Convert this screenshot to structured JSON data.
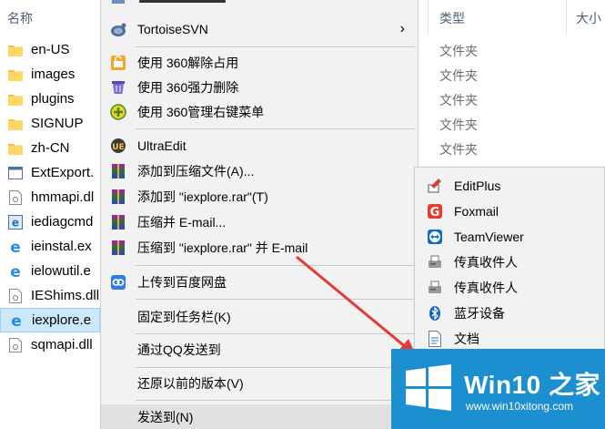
{
  "explorer": {
    "name_header": "名称",
    "type_header": "类型",
    "size_header": "大小",
    "files": [
      {
        "name": "en-US",
        "icon": "folder-icon"
      },
      {
        "name": "images",
        "icon": "folder-icon"
      },
      {
        "name": "plugins",
        "icon": "folder-icon"
      },
      {
        "name": "SIGNUP",
        "icon": "folder-icon"
      },
      {
        "name": "zh-CN",
        "icon": "folder-icon"
      },
      {
        "name": "ExtExport.",
        "icon": "app-icon"
      },
      {
        "name": "hmmapi.dl",
        "icon": "dll-icon"
      },
      {
        "name": "iediagcmd",
        "icon": "ie-diag-icon"
      },
      {
        "name": "ieinstal.ex",
        "icon": "ie-icon"
      },
      {
        "name": "ielowutil.e",
        "icon": "ie-icon"
      },
      {
        "name": "IEShims.dll",
        "icon": "dll-icon"
      },
      {
        "name": "iexplore.e",
        "icon": "ie-icon",
        "selected": true
      },
      {
        "name": "sqmapi.dll",
        "icon": "dll-icon"
      }
    ],
    "types": [
      "文件夹",
      "文件夹",
      "文件夹",
      "文件夹",
      "文件夹"
    ]
  },
  "context_menu": {
    "items": [
      {
        "label": "TortoiseSVN",
        "icon": "tortoisesvn-icon",
        "submenu": true
      },
      {
        "label": "使用 360解除占用",
        "icon": "360-unlock-icon"
      },
      {
        "label": "使用 360强力删除",
        "icon": "360-shred-icon"
      },
      {
        "label": "使用 360管理右键菜单",
        "icon": "360-manage-icon"
      },
      {
        "label": "UltraEdit",
        "icon": "ultraedit-icon"
      },
      {
        "label": "添加到压缩文件(A)...",
        "icon": "winrar-icon"
      },
      {
        "label": "添加到 \"iexplore.rar\"(T)",
        "icon": "winrar-icon"
      },
      {
        "label": "压缩并 E-mail...",
        "icon": "winrar-icon"
      },
      {
        "label": "压缩到 \"iexplore.rar\" 并 E-mail",
        "icon": "winrar-icon"
      },
      {
        "label": "上传到百度网盘",
        "icon": "baidu-netdisk-icon"
      },
      {
        "label": "固定到任务栏(K)"
      },
      {
        "label": "通过QQ发送到"
      },
      {
        "label": "还原以前的版本(V)"
      },
      {
        "label": "发送到(N)"
      }
    ]
  },
  "send_to_menu": {
    "items": [
      {
        "label": "EditPlus",
        "icon": "editplus-icon"
      },
      {
        "label": "Foxmail",
        "icon": "foxmail-icon"
      },
      {
        "label": "TeamViewer",
        "icon": "teamviewer-icon"
      },
      {
        "label": "传真收件人",
        "icon": "fax-icon"
      },
      {
        "label": "传真收件人",
        "icon": "fax-icon"
      },
      {
        "label": "蓝牙设备",
        "icon": "bluetooth-icon"
      },
      {
        "label": "文档",
        "icon": "documents-icon"
      }
    ]
  },
  "watermark": {
    "title": "Win10 之家",
    "url": "www.win10xitong.com"
  },
  "colors": {
    "menu_bg": "#f2f2f2",
    "hover_bg": "#e1e1e1",
    "selected_bg": "#cce8ff",
    "arrow": "#e53935",
    "watermark_bg": "#1b8fd0"
  }
}
